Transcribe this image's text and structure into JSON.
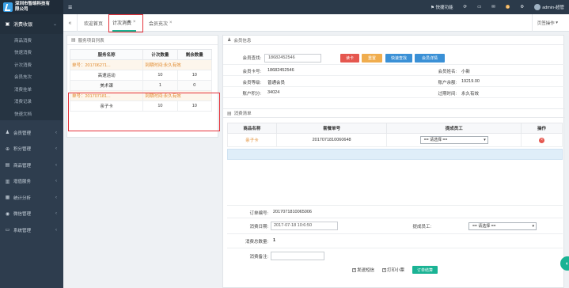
{
  "app": {
    "company_line1": "深圳市智络科技有",
    "company_line2": "限公司"
  },
  "topbar": {
    "quick_func": "快捷功能",
    "notify_count": "3",
    "user": "admin-超管"
  },
  "sidebar": {
    "consume": "消费收银",
    "sub_items": [
      "商品消费",
      "快速消费",
      "计次消费",
      "会员充次",
      "消费挂单",
      "消费记录",
      "快速文档"
    ],
    "items": [
      "会员管理",
      "积分管理",
      "商品管理",
      "增值服务",
      "统计分析",
      "微信管理",
      "系统管理"
    ]
  },
  "tabs": {
    "home": "欢迎首页",
    "count_consume": "计次消费",
    "member_charge": "会员充次",
    "close_ops": "页签操作"
  },
  "left_panel": {
    "title": "服务项目列表",
    "headers": [
      "服务名称",
      "计次数量",
      "剩余数量"
    ],
    "card1": {
      "no": "单号：201706271...",
      "expire": "到期时间:永久有效"
    },
    "rows1": [
      {
        "name": "高速运动",
        "count": "10",
        "remain": "10"
      },
      {
        "name": "美术课",
        "count": "1",
        "remain": "0"
      }
    ],
    "card2": {
      "no": "单号：201707181...",
      "expire": "到期时间:永久有效"
    },
    "rows2": [
      {
        "name": "亲子卡",
        "count": "10",
        "remain": "10"
      }
    ]
  },
  "member_info": {
    "title": "会员信息",
    "search_label": "会员查找:",
    "search_value": "18682452546",
    "btn_read": "读卡",
    "btn_clear": "重置",
    "btn_quick": "快速查找",
    "btn_detail": "会员详情",
    "card_no_label": "会员卡号:",
    "card_no": "18682452546",
    "name_label": "会员姓名:",
    "name": "小新",
    "level_label": "会员等级:",
    "level": "普通会员",
    "balance_label": "账户余额:",
    "balance": "19219.00",
    "points_label": "账户积分:",
    "points": "34024",
    "expire_label": "过期时间:",
    "expire": "永久有效"
  },
  "consume_list": {
    "title": "消费清单",
    "headers": [
      "商品名称",
      "套餐单号",
      "提成员工",
      "操作"
    ],
    "row": {
      "name": "亲子卡",
      "order": "2017071810060648",
      "staff": "== 请选择 =="
    }
  },
  "order_form": {
    "order_no_label": "订单编号:",
    "order_no": "2017071810065006",
    "date_label": "消费日期:",
    "date": "2017-07-18 10:6:50",
    "staff_label": "提成员工:",
    "staff": "== 请选择 ==",
    "total_label": "消费总数量:",
    "total": "1",
    "remark_label": "消费备注:",
    "sms": "发送短信",
    "print": "打印小票",
    "settle": "订单结算"
  },
  "colors": {
    "accent": "#1ab394",
    "brand_dark": "#2b3a4a",
    "highlight": "#e5323a"
  }
}
